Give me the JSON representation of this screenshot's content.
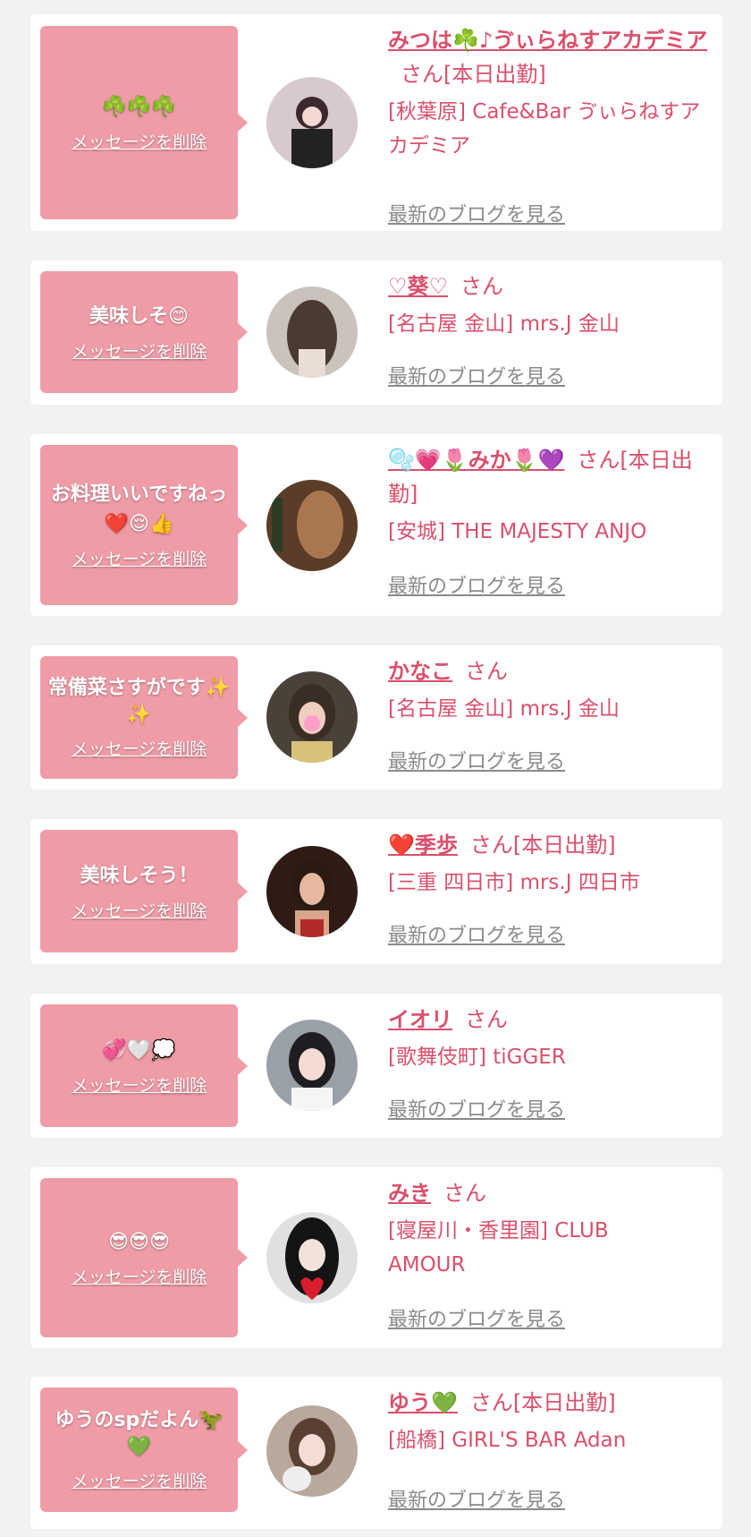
{
  "common": {
    "delete_label": "メッセージを削除",
    "blog_label": "最新のブログを見る",
    "san_label": "さん",
    "accent_color": "#d9506b",
    "bubble_color": "#ef9ca7"
  },
  "items": [
    {
      "message": "☘️☘️☘️",
      "name": "みつは☘️♪ゔぃらねすアカデミア",
      "status": "[本日出勤]",
      "shop": "[秋葉原] Cafe&Bar ゔぃらねすアカデミア"
    },
    {
      "message": "美味しそ😊",
      "name": "♡葵♡",
      "status": "",
      "shop": "[名古屋 金山] mrs.J 金山"
    },
    {
      "message": "お料理いいですねっ❤️😌👍",
      "name": "🫧💗🌷みか🌷💜",
      "status": "[本日出勤]",
      "shop": "[安城] THE MAJESTY ANJO"
    },
    {
      "message": "常備菜さすがです✨✨",
      "name": "かなこ",
      "status": "",
      "shop": "[名古屋 金山] mrs.J 金山"
    },
    {
      "message": "美味しそう！",
      "name": "❤️季歩",
      "status": "[本日出勤]",
      "shop": "[三重 四日市] mrs.J 四日市"
    },
    {
      "message": "💞🤍💭",
      "name": "イオリ",
      "status": "",
      "shop": "[歌舞伎町] tiGGER"
    },
    {
      "message": "😎😎😎",
      "name": "みき",
      "status": "",
      "shop": "[寝屋川・香里園] CLUB AMOUR"
    },
    {
      "message": "ゆうのspだよん🦖💚",
      "name": "ゆう💚",
      "status": "[本日出勤]",
      "shop": "[船橋] GIRL'S BAR Adan"
    }
  ]
}
